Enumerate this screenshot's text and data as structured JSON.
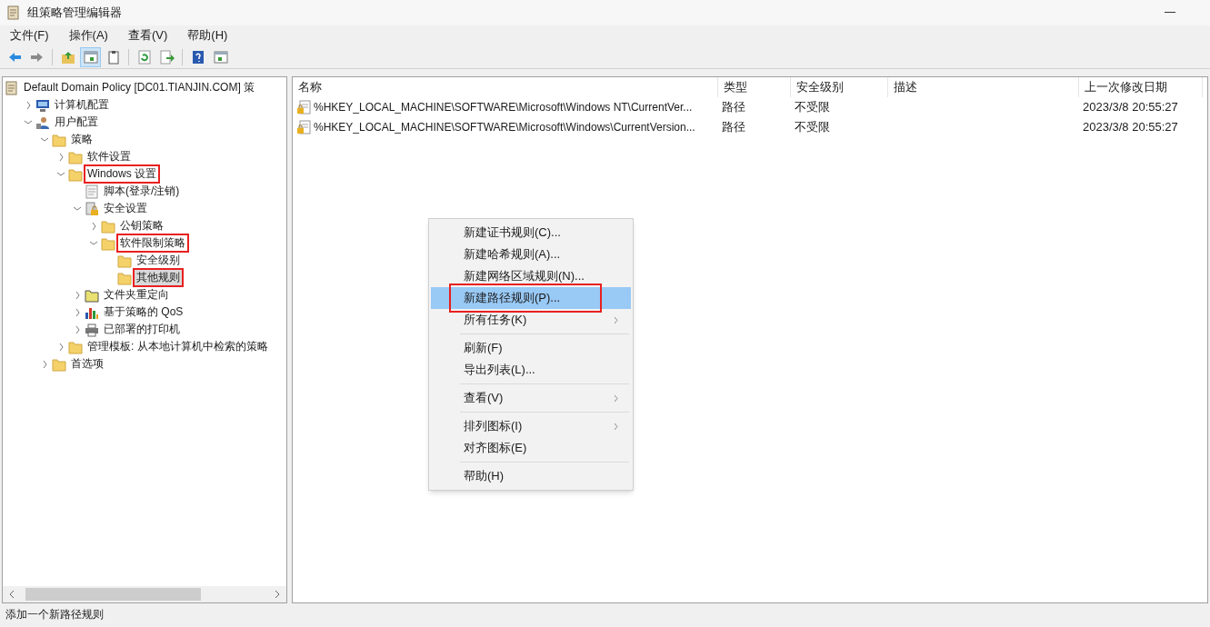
{
  "window": {
    "title": "组策略管理编辑器"
  },
  "menu_bar": [
    "文件(F)",
    "操作(A)",
    "查看(V)",
    "帮助(H)"
  ],
  "toolbar": [
    {
      "kind": "back",
      "pressed": false
    },
    {
      "kind": "forward",
      "pressed": false
    },
    {
      "kind": "up",
      "pressed": false
    },
    {
      "kind": "console-tree",
      "pressed": true
    },
    {
      "kind": "properties",
      "pressed": false
    },
    {
      "kind": "refresh",
      "pressed": false
    },
    {
      "kind": "export",
      "pressed": false
    },
    {
      "kind": "help",
      "pressed": false
    },
    {
      "kind": "action-pane",
      "pressed": false
    }
  ],
  "tree": {
    "label": "Default Domain Policy [DC01.TIANJIN.COM] 策",
    "kind": "policy",
    "children": [
      {
        "label": "计算机配置",
        "kind": "computer",
        "expanded": false,
        "selected": false,
        "highlighted": false
      },
      {
        "label": "用户配置",
        "kind": "user",
        "expanded": true,
        "selected": false,
        "highlighted": false,
        "children": [
          {
            "label": "策略",
            "kind": "folder",
            "expanded": true,
            "selected": false,
            "highlighted": false,
            "children": [
              {
                "label": "软件设置",
                "kind": "folder",
                "expanded": false,
                "selected": false,
                "highlighted": false
              },
              {
                "label": "Windows 设置",
                "kind": "folder",
                "expanded": true,
                "selected": false,
                "highlighted": true,
                "children": [
                  {
                    "label": "脚本(登录/注销)",
                    "kind": "script",
                    "selected": false,
                    "highlighted": false
                  },
                  {
                    "label": "安全设置",
                    "kind": "security",
                    "expanded": true,
                    "selected": false,
                    "highlighted": false,
                    "children": [
                      {
                        "label": "公钥策略",
                        "kind": "folder",
                        "expanded": false,
                        "selected": false,
                        "highlighted": false
                      },
                      {
                        "label": "软件限制策略",
                        "kind": "folder",
                        "expanded": true,
                        "selected": false,
                        "highlighted": true,
                        "children": [
                          {
                            "label": "安全级别",
                            "kind": "folder",
                            "selected": false,
                            "highlighted": false
                          },
                          {
                            "label": "其他规则",
                            "kind": "folder",
                            "selected": true,
                            "highlighted": true
                          }
                        ]
                      }
                    ]
                  },
                  {
                    "label": "文件夹重定向",
                    "kind": "folder-open",
                    "expanded": false,
                    "selected": false,
                    "highlighted": false
                  },
                  {
                    "label": "基于策略的 QoS",
                    "kind": "chart",
                    "expanded": false,
                    "selected": false,
                    "highlighted": false
                  },
                  {
                    "label": "已部署的打印机",
                    "kind": "printer",
                    "expanded": false,
                    "selected": false,
                    "highlighted": false
                  }
                ]
              },
              {
                "label": "管理模板: 从本地计算机中检索的策略",
                "kind": "folder",
                "expanded": false,
                "selected": false,
                "highlighted": false
              }
            ]
          },
          {
            "label": "首选项",
            "kind": "folder",
            "expanded": false,
            "selected": false,
            "highlighted": false
          }
        ]
      }
    ]
  },
  "table": {
    "columns": [
      "名称",
      "类型",
      "安全级别",
      "描述",
      "上一次修改日期"
    ],
    "rows": [
      {
        "name": "%HKEY_LOCAL_MACHINE\\SOFTWARE\\Microsoft\\Windows NT\\CurrentVer...",
        "type": "路径",
        "level": "不受限",
        "modified": "2023/3/8  20:55:27"
      },
      {
        "name": "%HKEY_LOCAL_MACHINE\\SOFTWARE\\Microsoft\\Windows\\CurrentVersion...",
        "type": "路径",
        "level": "不受限",
        "modified": "2023/3/8  20:55:27"
      }
    ]
  },
  "context_menu": [
    {
      "kind": "item",
      "label": "新建证书规则(C)...",
      "selected": false,
      "highlighted": false
    },
    {
      "kind": "item",
      "label": "新建哈希规则(A)...",
      "selected": false,
      "highlighted": false
    },
    {
      "kind": "item",
      "label": "新建网络区域规则(N)...",
      "selected": false,
      "highlighted": false
    },
    {
      "kind": "item",
      "label": "新建路径规则(P)...",
      "selected": true,
      "highlighted": true
    },
    {
      "kind": "submenu",
      "label": "所有任务(K)",
      "selected": false,
      "highlighted": false
    },
    {
      "kind": "separator"
    },
    {
      "kind": "item",
      "label": "刷新(F)",
      "selected": false,
      "highlighted": false
    },
    {
      "kind": "item",
      "label": "导出列表(L)...",
      "selected": false,
      "highlighted": false
    },
    {
      "kind": "separator"
    },
    {
      "kind": "submenu",
      "label": "查看(V)",
      "selected": false,
      "highlighted": false
    },
    {
      "kind": "separator"
    },
    {
      "kind": "submenu",
      "label": "排列图标(I)",
      "selected": false,
      "highlighted": false
    },
    {
      "kind": "item",
      "label": "对齐图标(E)",
      "selected": false,
      "highlighted": false
    },
    {
      "kind": "separator"
    },
    {
      "kind": "item",
      "label": "帮助(H)",
      "selected": false,
      "highlighted": false
    }
  ],
  "status_bar": "添加一个新路径规则"
}
